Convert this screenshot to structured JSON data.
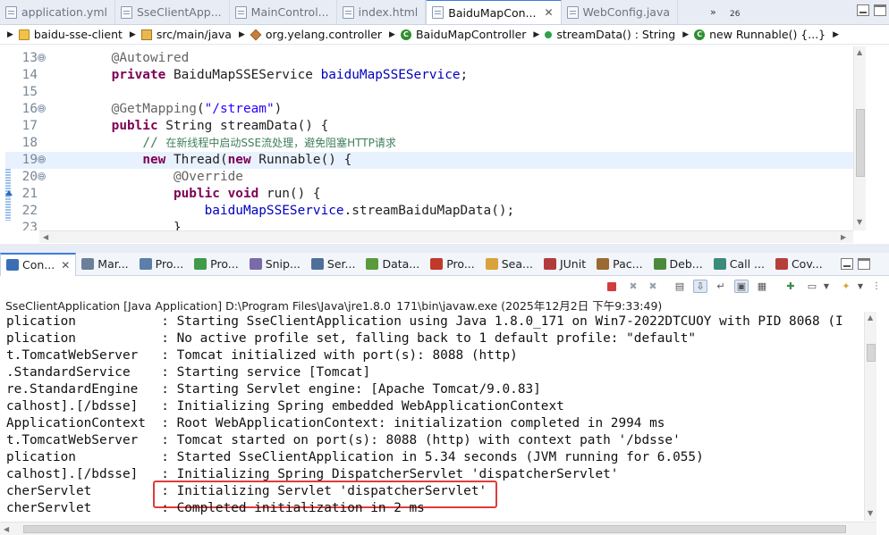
{
  "editor_tabs": [
    {
      "label": "application.yml",
      "active": false
    },
    {
      "label": "SseClientApp...",
      "active": false
    },
    {
      "label": "MainControl...",
      "active": false
    },
    {
      "label": "index.html",
      "active": false
    },
    {
      "label": "BaiduMapCon...",
      "active": true
    },
    {
      "label": "WebConfig.java",
      "active": false
    }
  ],
  "tab_overflow": {
    "chevron": "»",
    "count": "26"
  },
  "breadcrumb": [
    {
      "label": "baidu-sse-client",
      "icon": "project-icon"
    },
    {
      "label": "src/main/java",
      "icon": "source-folder-icon"
    },
    {
      "label": "org.yelang.controller",
      "icon": "package-icon"
    },
    {
      "label": "BaiduMapController",
      "icon": "class-icon"
    },
    {
      "label": "streamData() : String",
      "icon": "method-icon"
    },
    {
      "label": "new Runnable() {...}",
      "icon": "anonymous-class-icon"
    }
  ],
  "code_lines": [
    {
      "num": "13",
      "fold": "⊖",
      "parts": [
        {
          "t": "    "
        },
        {
          "t": "@Autowired",
          "c": "ann"
        }
      ]
    },
    {
      "num": "14",
      "fold": "",
      "parts": [
        {
          "t": "    "
        },
        {
          "t": "private",
          "c": "kw"
        },
        {
          "t": " BaiduMapSSEService "
        },
        {
          "t": "baiduMapSSEService",
          "c": "fld"
        },
        {
          "t": ";"
        }
      ]
    },
    {
      "num": "15",
      "fold": "",
      "parts": [
        {
          "t": ""
        }
      ]
    },
    {
      "num": "16",
      "fold": "⊖",
      "parts": [
        {
          "t": "    "
        },
        {
          "t": "@GetMapping",
          "c": "ann"
        },
        {
          "t": "("
        },
        {
          "t": "\"/stream\"",
          "c": "str"
        },
        {
          "t": ")"
        }
      ]
    },
    {
      "num": "17",
      "fold": "",
      "parts": [
        {
          "t": "    "
        },
        {
          "t": "public",
          "c": "kw"
        },
        {
          "t": " String streamData() {"
        }
      ]
    },
    {
      "num": "18",
      "fold": "",
      "parts": [
        {
          "t": "        "
        },
        {
          "t": "// ",
          "c": "cmt"
        },
        {
          "t": "在新线程中启动SSE流处理，避免阻塞HTTP请求",
          "c": "cmt cmt-cjk"
        }
      ]
    },
    {
      "num": "19",
      "fold": "⊖",
      "current": true,
      "parts": [
        {
          "t": "        "
        },
        {
          "t": "new",
          "c": "kw"
        },
        {
          "t": " Thread("
        },
        {
          "t": "new",
          "c": "kw"
        },
        {
          "t": " Runnable() {"
        }
      ]
    },
    {
      "num": "20",
      "fold": "⊖",
      "parts": [
        {
          "t": "            "
        },
        {
          "t": "@Override",
          "c": "ann"
        }
      ]
    },
    {
      "num": "21",
      "fold": "",
      "parts": [
        {
          "t": "            "
        },
        {
          "t": "public",
          "c": "kw"
        },
        {
          "t": " "
        },
        {
          "t": "void",
          "c": "kw"
        },
        {
          "t": " run() {"
        }
      ]
    },
    {
      "num": "22",
      "fold": "",
      "parts": [
        {
          "t": "                "
        },
        {
          "t": "baiduMapSSEService",
          "c": "fld"
        },
        {
          "t": ".streamBaiduMapData();"
        }
      ]
    },
    {
      "num": "23",
      "fold": "",
      "parts": [
        {
          "t": "            }"
        }
      ]
    }
  ],
  "view_tabs": [
    {
      "label": "Con...",
      "active": true,
      "icon": "console-icon",
      "color": "#3a6fb5"
    },
    {
      "label": "Mar...",
      "active": false,
      "icon": "markers-icon",
      "color": "#6b7f99"
    },
    {
      "label": "Pro...",
      "active": false,
      "icon": "properties-icon",
      "color": "#5c7fa8"
    },
    {
      "label": "Pro...",
      "active": false,
      "icon": "progress-icon",
      "color": "#3f9a4a"
    },
    {
      "label": "Snip...",
      "active": false,
      "icon": "snippets-icon",
      "color": "#7a6aa8"
    },
    {
      "label": "Ser...",
      "active": false,
      "icon": "servers-icon",
      "color": "#4f6f98"
    },
    {
      "label": "Data...",
      "active": false,
      "icon": "data-source-icon",
      "color": "#5b9a3c"
    },
    {
      "label": "Pro...",
      "active": false,
      "icon": "problems-icon",
      "color": "#c0392b"
    },
    {
      "label": "Sea...",
      "active": false,
      "icon": "search-icon",
      "color": "#d8a33a"
    },
    {
      "label": "JUnit",
      "active": false,
      "icon": "junit-icon",
      "color": "#b23a3a"
    },
    {
      "label": "Pac...",
      "active": false,
      "icon": "package-explorer-icon",
      "color": "#9a6a33"
    },
    {
      "label": "Deb...",
      "active": false,
      "icon": "debug-icon",
      "color": "#4a8a3a"
    },
    {
      "label": "Call ...",
      "active": false,
      "icon": "call-hierarchy-icon",
      "color": "#3d8a7a"
    },
    {
      "label": "Cov...",
      "active": false,
      "icon": "coverage-icon",
      "color": "#b5403a"
    }
  ],
  "console_header": "SseClientApplication [Java Application] D:\\Program Files\\Java\\jre1.8.0_171\\bin\\javaw.exe  (2025年12月2日 下午9:33:49)",
  "console_lines": [
    "plication           : Starting SseClientApplication using Java 1.8.0_171 on Win7-2022DTCUOY with PID 8068 (I",
    "plication           : No active profile set, falling back to 1 default profile: \"default\"",
    "t.TomcatWebServer   : Tomcat initialized with port(s): 8088 (http)",
    ".StandardService    : Starting service [Tomcat]",
    "re.StandardEngine   : Starting Servlet engine: [Apache Tomcat/9.0.83]",
    "calhost].[/bdsse]   : Initializing Spring embedded WebApplicationContext",
    "ApplicationContext  : Root WebApplicationContext: initialization completed in 2994 ms",
    "t.TomcatWebServer   : Tomcat started on port(s): 8088 (http) with context path '/bdsse'",
    "plication           : Started SseClientApplication in 5.34 seconds (JVM running for 6.055)",
    "calhost].[/bdsse]   : Initializing Spring DispatcherServlet 'dispatcherServlet'",
    "cherServlet         : Initializing Servlet 'dispatcherServlet'",
    "cherServlet         : Completed initialization in 2 ms"
  ],
  "colors": {
    "highlight_border": "#e03b3b",
    "active_tab_accent": "#3b7ddd",
    "current_line": "#e8f2fe"
  }
}
